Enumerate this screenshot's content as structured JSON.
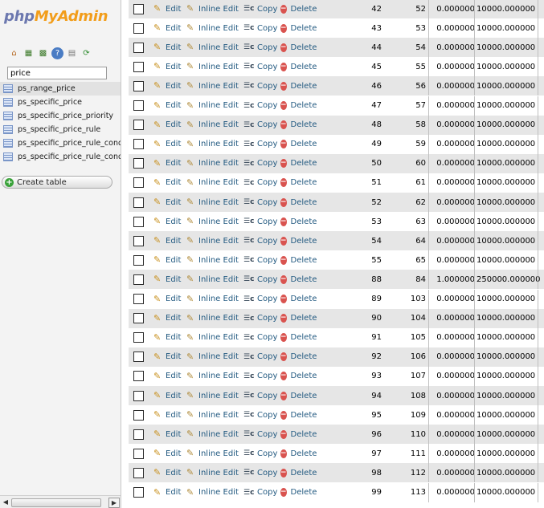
{
  "sidebar": {
    "logo_php": "php",
    "logo_myadmin": "MyAdmin",
    "toolbar_icons": [
      "home-icon",
      "exit-icon",
      "sql-query-icon",
      "docs-icon",
      "help-icon",
      "reload-icon"
    ],
    "filter_value": "price",
    "tables": [
      {
        "label": "ps_range_price",
        "selected": true
      },
      {
        "label": "ps_specific_price",
        "selected": false
      },
      {
        "label": "ps_specific_price_priority",
        "selected": false
      },
      {
        "label": "ps_specific_price_rule",
        "selected": false
      },
      {
        "label": "ps_specific_price_rule_cond",
        "selected": false
      },
      {
        "label": "ps_specific_price_rule_cond",
        "selected": false
      }
    ],
    "create_table_label": "Create table"
  },
  "actions": {
    "edit": "Edit",
    "inline_edit": "Inline Edit",
    "copy": "Copy",
    "delete": "Delete"
  },
  "rows": [
    {
      "c1": "42",
      "c2": "52",
      "c3": "0.000000",
      "c4": "10000.000000"
    },
    {
      "c1": "43",
      "c2": "53",
      "c3": "0.000000",
      "c4": "10000.000000"
    },
    {
      "c1": "44",
      "c2": "54",
      "c3": "0.000000",
      "c4": "10000.000000"
    },
    {
      "c1": "45",
      "c2": "55",
      "c3": "0.000000",
      "c4": "10000.000000"
    },
    {
      "c1": "46",
      "c2": "56",
      "c3": "0.000000",
      "c4": "10000.000000"
    },
    {
      "c1": "47",
      "c2": "57",
      "c3": "0.000000",
      "c4": "10000.000000"
    },
    {
      "c1": "48",
      "c2": "58",
      "c3": "0.000000",
      "c4": "10000.000000"
    },
    {
      "c1": "49",
      "c2": "59",
      "c3": "0.000000",
      "c4": "10000.000000"
    },
    {
      "c1": "50",
      "c2": "60",
      "c3": "0.000000",
      "c4": "10000.000000"
    },
    {
      "c1": "51",
      "c2": "61",
      "c3": "0.000000",
      "c4": "10000.000000"
    },
    {
      "c1": "52",
      "c2": "62",
      "c3": "0.000000",
      "c4": "10000.000000"
    },
    {
      "c1": "53",
      "c2": "63",
      "c3": "0.000000",
      "c4": "10000.000000"
    },
    {
      "c1": "54",
      "c2": "64",
      "c3": "0.000000",
      "c4": "10000.000000"
    },
    {
      "c1": "55",
      "c2": "65",
      "c3": "0.000000",
      "c4": "10000.000000"
    },
    {
      "c1": "88",
      "c2": "84",
      "c3": "1.000000",
      "c4": "250000.000000"
    },
    {
      "c1": "89",
      "c2": "103",
      "c3": "0.000000",
      "c4": "10000.000000"
    },
    {
      "c1": "90",
      "c2": "104",
      "c3": "0.000000",
      "c4": "10000.000000"
    },
    {
      "c1": "91",
      "c2": "105",
      "c3": "0.000000",
      "c4": "10000.000000"
    },
    {
      "c1": "92",
      "c2": "106",
      "c3": "0.000000",
      "c4": "10000.000000"
    },
    {
      "c1": "93",
      "c2": "107",
      "c3": "0.000000",
      "c4": "10000.000000"
    },
    {
      "c1": "94",
      "c2": "108",
      "c3": "0.000000",
      "c4": "10000.000000"
    },
    {
      "c1": "95",
      "c2": "109",
      "c3": "0.000000",
      "c4": "10000.000000"
    },
    {
      "c1": "96",
      "c2": "110",
      "c3": "0.000000",
      "c4": "10000.000000"
    },
    {
      "c1": "97",
      "c2": "111",
      "c3": "0.000000",
      "c4": "10000.000000"
    },
    {
      "c1": "98",
      "c2": "112",
      "c3": "0.000000",
      "c4": "10000.000000"
    },
    {
      "c1": "99",
      "c2": "113",
      "c3": "0.000000",
      "c4": "10000.000000"
    }
  ]
}
